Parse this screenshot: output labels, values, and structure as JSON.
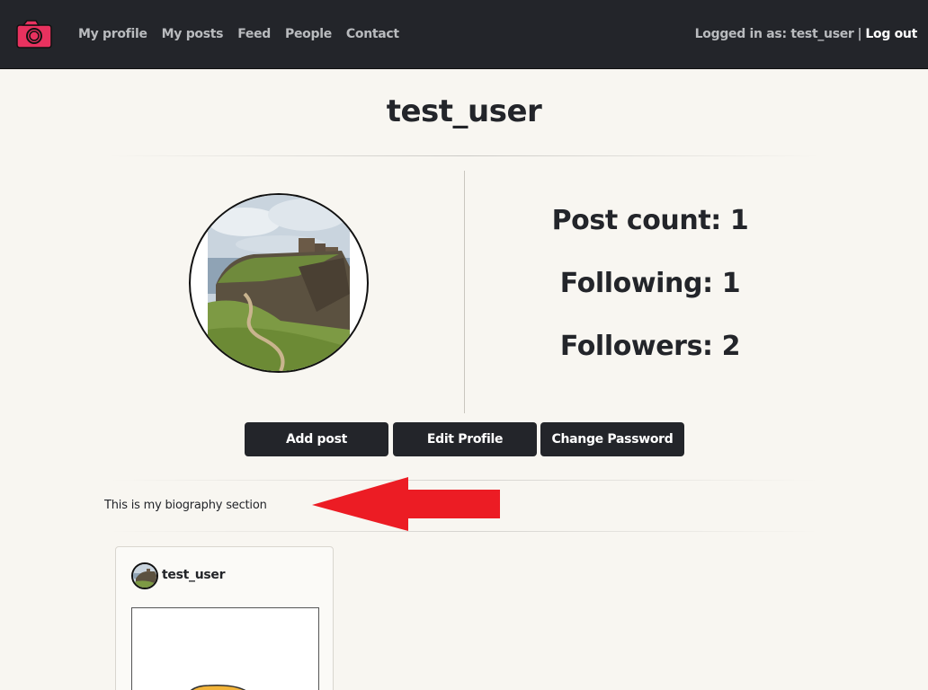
{
  "navbar": {
    "brand_icon": "camera-icon",
    "brand_color": "#e8325f",
    "links": [
      "My profile",
      "My posts",
      "Feed",
      "People",
      "Contact"
    ],
    "logged_in_text": "Logged in as: test_user",
    "separator": "|",
    "logout_label": "Log out"
  },
  "profile": {
    "username": "test_user",
    "avatar_icon": "castle-photo",
    "stats": {
      "post_count": "Post count: 1",
      "following": "Following: 1",
      "followers": "Followers: 2"
    },
    "buttons": {
      "add_post": "Add post",
      "edit_profile": "Edit Profile",
      "change_password": "Change Password"
    },
    "biography": "This is my biography section",
    "annotation_icon": "red-arrow-left-icon"
  },
  "posts": [
    {
      "username": "test_user"
    }
  ],
  "colors": {
    "navbar_bg": "#23252a",
    "page_bg": "#f8f6f1",
    "button_bg": "#23252a",
    "annotation_red": "#ec1c24"
  }
}
